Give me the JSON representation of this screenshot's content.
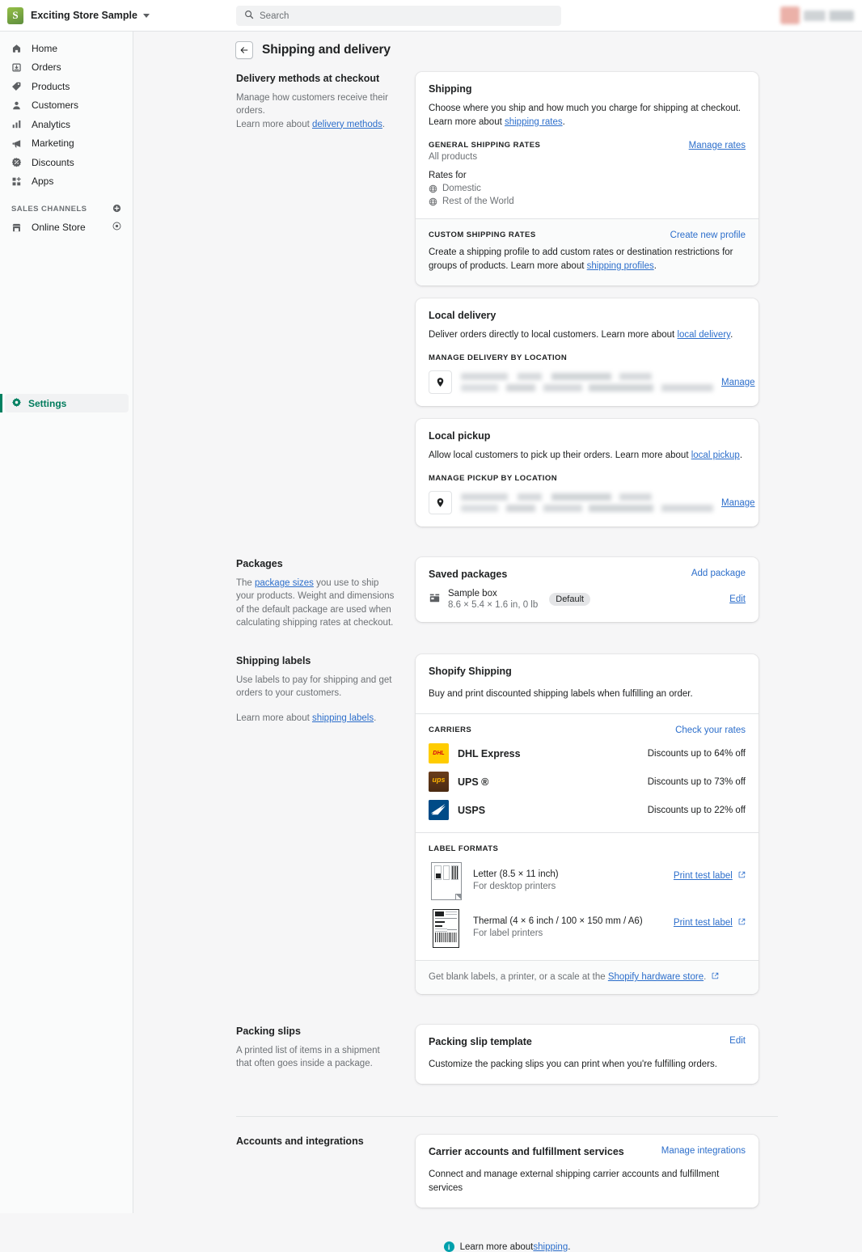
{
  "topbar": {
    "store_name": "Exciting Store Sample",
    "logo_glyph": "S",
    "search_placeholder": "Search",
    "account_redacted": true
  },
  "sidebar": {
    "items": [
      {
        "label": "Home",
        "icon": "home-icon"
      },
      {
        "label": "Orders",
        "icon": "orders-icon"
      },
      {
        "label": "Products",
        "icon": "products-tag-icon"
      },
      {
        "label": "Customers",
        "icon": "customers-person-icon"
      },
      {
        "label": "Analytics",
        "icon": "analytics-bars-icon"
      },
      {
        "label": "Marketing",
        "icon": "marketing-megaphone-icon"
      },
      {
        "label": "Discounts",
        "icon": "discounts-percent-icon"
      },
      {
        "label": "Apps",
        "icon": "apps-grid-icon"
      }
    ],
    "sales_channels_label": "SALES CHANNELS",
    "channels": [
      {
        "label": "Online Store",
        "icon": "storefront-icon"
      }
    ],
    "settings": {
      "label": "Settings",
      "icon": "gear-icon",
      "active": true
    },
    "accent_color": "#008060"
  },
  "page": {
    "title": "Shipping and delivery",
    "back_label": "←"
  },
  "sections": {
    "delivery_methods": {
      "heading": "Delivery methods at checkout",
      "desc_1": "Manage how customers receive their orders.",
      "desc_2_prefix": "Learn more about ",
      "desc_2_link": "delivery methods",
      "desc_2_suffix": "."
    },
    "shipping_card": {
      "title": "Shipping",
      "desc_prefix": "Choose where you ship and how much you charge for shipping at checkout. Learn more about ",
      "desc_link": "shipping rates",
      "desc_suffix": ".",
      "general_label": "GENERAL SHIPPING RATES",
      "general_sub": "All products",
      "manage_rates_link": "Manage rates",
      "rates_for_label": "Rates for",
      "rates": [
        "Domestic",
        "Rest of the World"
      ],
      "custom_label": "CUSTOM SHIPPING RATES",
      "create_profile_link": "Create new profile",
      "custom_desc_prefix": "Create a shipping profile to add custom rates or destination restrictions for groups of products. Learn more about ",
      "custom_desc_link": "shipping profiles",
      "custom_desc_suffix": "."
    },
    "local_delivery": {
      "title": "Local delivery",
      "desc_prefix": "Deliver orders directly to local customers. Learn more about ",
      "desc_link": "local delivery",
      "desc_suffix": ".",
      "manage_label": "MANAGE DELIVERY BY LOCATION",
      "location_name_redacted": true,
      "manage_link": "Manage"
    },
    "local_pickup": {
      "title": "Local pickup",
      "desc_prefix": "Allow local customers to pick up their orders. Learn more about ",
      "desc_link": "local pickup",
      "desc_suffix": ".",
      "manage_label": "MANAGE PICKUP BY LOCATION",
      "location_name_redacted": true,
      "manage_link": "Manage"
    },
    "packages": {
      "heading": "Packages",
      "desc_prefix": "The ",
      "desc_link": "package sizes",
      "desc_suffix": " you use to ship your products. Weight and dimensions of the default package are used when calculating shipping rates at checkout.",
      "card_title": "Saved packages",
      "add_link": "Add package",
      "items": [
        {
          "name": "Sample box",
          "dims": "8.6 × 5.4 × 1.6 in, 0 lb",
          "badge": "Default",
          "edit_link": "Edit"
        }
      ]
    },
    "shipping_labels": {
      "heading": "Shipping labels",
      "desc_1": "Use labels to pay for shipping and get orders to your customers.",
      "desc_2_prefix": "Learn more about ",
      "desc_2_link": "shipping labels",
      "desc_2_suffix": ".",
      "card_title": "Shopify Shipping",
      "card_desc": "Buy and print discounted shipping labels when fulfilling an order.",
      "carriers_label": "CARRIERS",
      "check_rates_link": "Check your rates",
      "carriers": [
        {
          "name": "DHL Express",
          "discount": "Discounts up to 64% off",
          "logo": "dhl-logo",
          "logo_bg": "#ffcc00",
          "logo_fg": "#d40511",
          "logo_text": "DHL"
        },
        {
          "name": "UPS ®",
          "discount": "Discounts up to 73% off",
          "logo": "ups-logo",
          "logo_bg": "#5a3318",
          "logo_fg": "#ffb500",
          "logo_text": "ups"
        },
        {
          "name": "USPS",
          "discount": "Discounts up to 22% off",
          "logo": "usps-logo",
          "logo_bg": "#004b87",
          "logo_fg": "#ffffff",
          "logo_text": ""
        }
      ],
      "formats_label": "LABEL FORMATS",
      "formats": [
        {
          "name": "Letter (8.5 × 11 inch)",
          "sub": "For desktop printers",
          "link": "Print test label"
        },
        {
          "name": "Thermal (4 × 6 inch / 100 × 150 mm / A6)",
          "sub": "For label printers",
          "link": "Print test label"
        }
      ],
      "footer_prefix": "Get blank labels, a printer, or a scale at the ",
      "footer_link": "Shopify hardware store",
      "footer_suffix": "."
    },
    "packing_slips": {
      "heading": "Packing slips",
      "desc": "A printed list of items in a shipment that often goes inside a package.",
      "card_title": "Packing slip template",
      "edit_link": "Edit",
      "card_desc": "Customize the packing slips you can print when you're fulfilling orders."
    },
    "accounts": {
      "heading": "Accounts and integrations",
      "card_title": "Carrier accounts and fulfillment services",
      "manage_link": "Manage integrations",
      "card_desc": "Connect and manage external shipping carrier accounts and fulfillment services"
    },
    "footer": {
      "prefix": "Learn more about ",
      "link": "shipping",
      "suffix": ".",
      "icon": "info-icon"
    }
  }
}
